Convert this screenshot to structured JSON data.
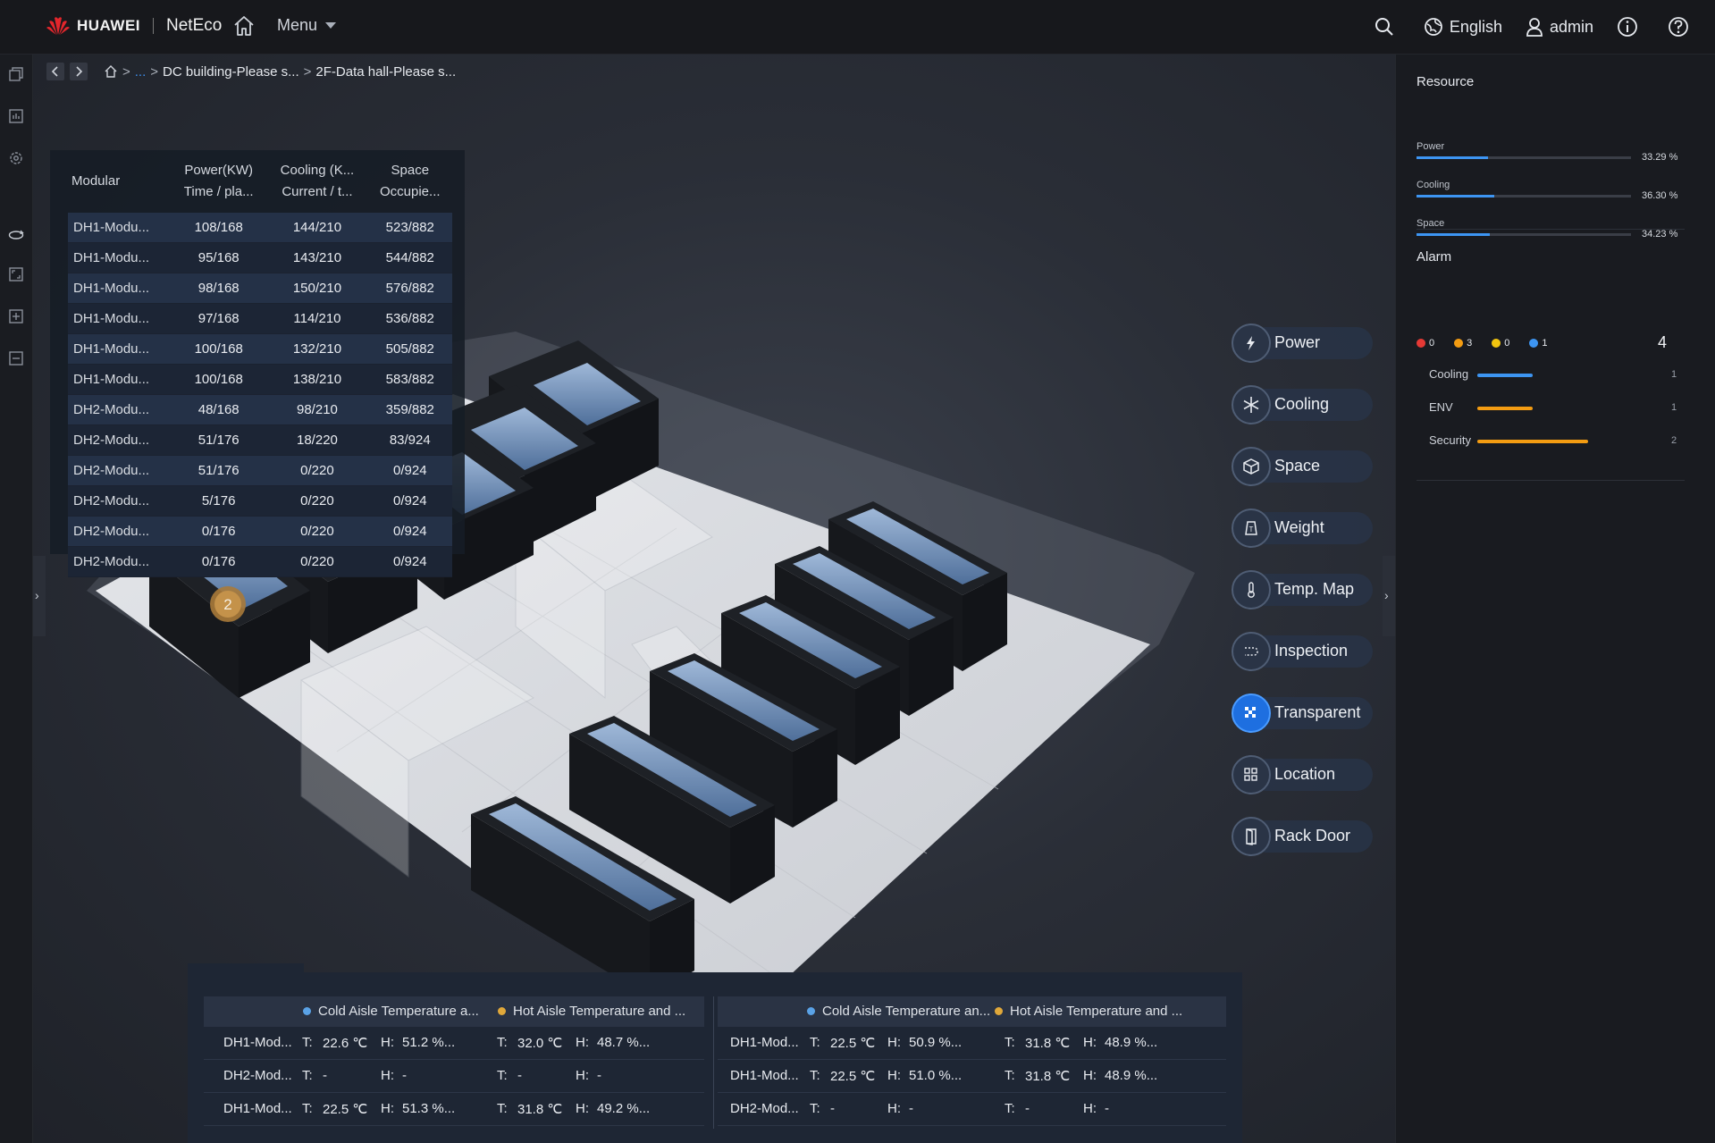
{
  "header": {
    "brand": "HUAWEI",
    "product": "NetEco",
    "menu_label": "Menu",
    "language": "English",
    "user": "admin"
  },
  "breadcrumb": {
    "ellipsis": "...",
    "items": [
      "DC building-Please s...",
      "2F-Data hall-Please s..."
    ]
  },
  "modular_table": {
    "headers": {
      "modular": "Modular",
      "power_1": "Power(KW)",
      "power_2": "Time / pla...",
      "cooling_1": "Cooling (K...",
      "cooling_2": "Current / t...",
      "space_1": "Space",
      "space_2": "Occupie..."
    },
    "rows": [
      {
        "name": "DH1-Modu...",
        "power": "108/168",
        "cooling": "144/210",
        "space": "523/882"
      },
      {
        "name": "DH1-Modu...",
        "power": "95/168",
        "cooling": "143/210",
        "space": "544/882"
      },
      {
        "name": "DH1-Modu...",
        "power": "98/168",
        "cooling": "150/210",
        "space": "576/882"
      },
      {
        "name": "DH1-Modu...",
        "power": "97/168",
        "cooling": "114/210",
        "space": "536/882"
      },
      {
        "name": "DH1-Modu...",
        "power": "100/168",
        "cooling": "132/210",
        "space": "505/882"
      },
      {
        "name": "DH1-Modu...",
        "power": "100/168",
        "cooling": "138/210",
        "space": "583/882"
      },
      {
        "name": "DH2-Modu...",
        "power": "48/168",
        "cooling": "98/210",
        "space": "359/882"
      },
      {
        "name": "DH2-Modu...",
        "power": "51/176",
        "cooling": "18/220",
        "space": "83/924"
      },
      {
        "name": "DH2-Modu...",
        "power": "51/176",
        "cooling": "0/220",
        "space": "0/924"
      },
      {
        "name": "DH2-Modu...",
        "power": "5/176",
        "cooling": "0/220",
        "space": "0/924"
      },
      {
        "name": "DH2-Modu...",
        "power": "0/176",
        "cooling": "0/220",
        "space": "0/924"
      },
      {
        "name": "DH2-Modu...",
        "power": "0/176",
        "cooling": "0/220",
        "space": "0/924"
      }
    ]
  },
  "scene": {
    "marker_count": "2"
  },
  "functions": [
    {
      "label": "Power",
      "icon": "lightning-icon",
      "active": false
    },
    {
      "label": "Cooling",
      "icon": "snowflake-icon",
      "active": false
    },
    {
      "label": "Space",
      "icon": "cube-icon",
      "active": false
    },
    {
      "label": "Weight",
      "icon": "weight-icon",
      "active": false
    },
    {
      "label": "Temp. Map",
      "icon": "thermometer-icon",
      "active": false
    },
    {
      "label": "Inspection",
      "icon": "inspection-icon",
      "active": false
    },
    {
      "label": "Transparent",
      "icon": "transparent-icon",
      "active": true
    },
    {
      "label": "Location",
      "icon": "location-grid-icon",
      "active": false
    },
    {
      "label": "Rack Door",
      "icon": "door-icon",
      "active": false
    }
  ],
  "resource": {
    "title": "Resource",
    "items": [
      {
        "label": "Power",
        "value": "33.29 %",
        "fraction": 0.3329
      },
      {
        "label": "Cooling",
        "value": "36.30 %",
        "fraction": 0.363
      },
      {
        "label": "Space",
        "value": "34.23 %",
        "fraction": 0.3423
      }
    ]
  },
  "alarm": {
    "title": "Alarm",
    "counts": [
      {
        "level": "critical",
        "count": "0",
        "color": "#e53935"
      },
      {
        "level": "major",
        "count": "3",
        "color": "#f39c12"
      },
      {
        "level": "minor",
        "count": "0",
        "color": "#f1c40f"
      },
      {
        "level": "warning",
        "count": "1",
        "color": "#3d95f2"
      }
    ],
    "total": "4",
    "categories": [
      {
        "label": "Cooling",
        "count": "1",
        "color": "#3d95f2",
        "fraction": 0.5
      },
      {
        "label": "ENV",
        "count": "1",
        "color": "#f39c12",
        "fraction": 0.5
      },
      {
        "label": "Security",
        "count": "2",
        "color": "#f39c12",
        "fraction": 1.0
      }
    ]
  },
  "temperature": {
    "legend_cold": "Cold Aisle Temperature a...",
    "legend_hot": "Hot Aisle Temperature and ...",
    "legend_cold_2": "Cold Aisle Temperature an...",
    "legend_hot_2": "Hot Aisle Temperature and ...",
    "cold_color": "#5aa2e6",
    "hot_color": "#e0a83a",
    "left_rows": [
      {
        "name": "DH1-Mod...",
        "ct": "22.6 ℃",
        "ch": "51.2 %...",
        "ht": "32.0 ℃",
        "hh": "48.7 %..."
      },
      {
        "name": "DH2-Mod...",
        "ct": "-",
        "ch": "-",
        "ht": "-",
        "hh": "-"
      },
      {
        "name": "DH1-Mod...",
        "ct": "22.5 ℃",
        "ch": "51.3 %...",
        "ht": "31.8 ℃",
        "hh": "49.2 %..."
      }
    ],
    "right_rows": [
      {
        "name": "DH1-Mod...",
        "ct": "22.5 ℃",
        "ch": "50.9 %...",
        "ht": "31.8 ℃",
        "hh": "48.9 %..."
      },
      {
        "name": "DH1-Mod...",
        "ct": "22.5 ℃",
        "ch": "51.0 %...",
        "ht": "31.8 ℃",
        "hh": "48.9 %..."
      },
      {
        "name": "DH2-Mod...",
        "ct": "-",
        "ch": "-",
        "ht": "-",
        "hh": "-"
      }
    ],
    "t_prefix": "T:",
    "h_prefix": "H:"
  }
}
